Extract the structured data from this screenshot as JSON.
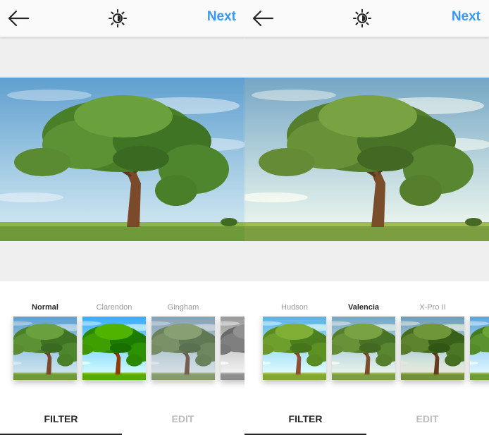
{
  "left": {
    "next_label": "Next",
    "filters": [
      {
        "label": "Normal",
        "selected": true
      },
      {
        "label": "Clarendon",
        "selected": false
      },
      {
        "label": "Gingham",
        "selected": false
      },
      {
        "label": "",
        "selected": false
      }
    ],
    "tabs": {
      "filter": "FILTER",
      "edit": "EDIT",
      "active": "filter"
    }
  },
  "right": {
    "next_label": "Next",
    "filters": [
      {
        "label": "Hudson",
        "selected": false
      },
      {
        "label": "Valencia",
        "selected": true
      },
      {
        "label": "X-Pro II",
        "selected": false
      },
      {
        "label": "",
        "selected": false
      }
    ],
    "tabs": {
      "filter": "FILTER",
      "edit": "EDIT",
      "active": "filter"
    }
  },
  "colors": {
    "accent": "#3897f0",
    "active_text": "#262626",
    "inactive_text": "#bbbbbb"
  },
  "icons": {
    "back": "arrow-left-icon",
    "lux": "brightness-icon"
  }
}
